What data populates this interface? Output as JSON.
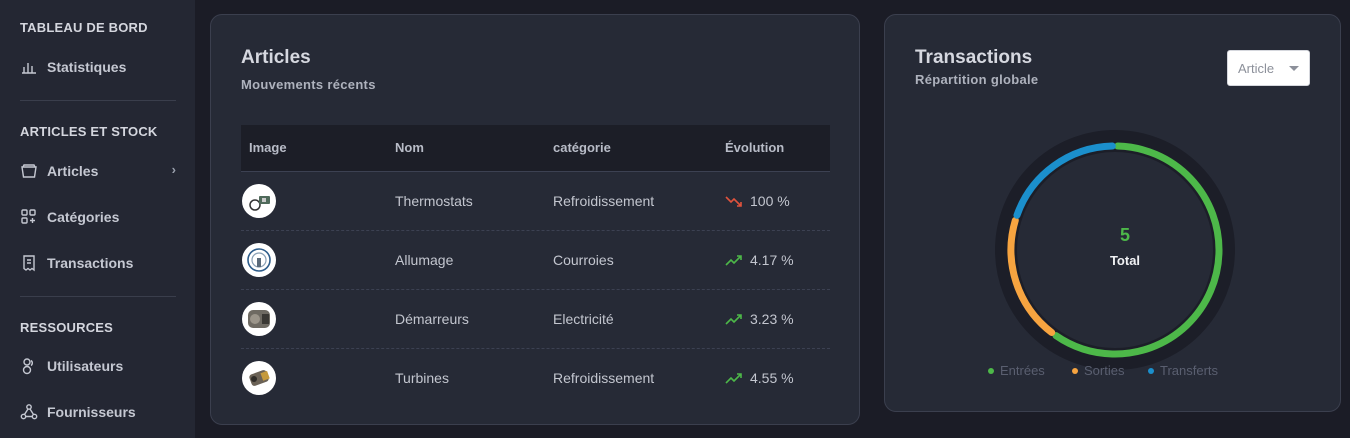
{
  "sidebar": {
    "sections": [
      {
        "title": "TABLEAU DE BORD",
        "items": [
          {
            "label": "Statistiques",
            "icon": "bar-chart-icon"
          }
        ]
      },
      {
        "title": "ARTICLES ET STOCK",
        "items": [
          {
            "label": "Articles",
            "icon": "basket-icon",
            "chevron": "›"
          },
          {
            "label": "Catégories",
            "icon": "category-icon"
          },
          {
            "label": "Transactions",
            "icon": "receipt-icon"
          }
        ]
      },
      {
        "title": "RESSOURCES",
        "items": [
          {
            "label": "Utilisateurs",
            "icon": "users-icon"
          },
          {
            "label": "Fournisseurs",
            "icon": "supplier-network-icon"
          }
        ]
      }
    ]
  },
  "articles_card": {
    "title": "Articles",
    "subtitle": "Mouvements récents",
    "columns": [
      "Image",
      "Nom",
      "catégorie",
      "Évolution"
    ],
    "rows": [
      {
        "thumb": "thermostat-thumbnail",
        "name": "Thermostats",
        "category": "Refroidissement",
        "trend": "down",
        "evolution": "100 %"
      },
      {
        "thumb": "ignition-thumbnail",
        "name": "Allumage",
        "category": "Courroies",
        "trend": "up",
        "evolution": "4.17 %"
      },
      {
        "thumb": "starter-thumbnail",
        "name": "Démarreurs",
        "category": "Electricité",
        "trend": "up",
        "evolution": "3.23 %"
      },
      {
        "thumb": "turbine-thumbnail",
        "name": "Turbines",
        "category": "Refroidissement",
        "trend": "up",
        "evolution": "4.55 %"
      }
    ],
    "colors": {
      "up": "#4db849",
      "down": "#e0533d"
    }
  },
  "transactions_card": {
    "title": "Transactions",
    "subtitle": "Répartition globale",
    "dropdown_value": "Article",
    "center_value": "5",
    "center_label": "Total",
    "legend": [
      {
        "label": "Entrées",
        "color": "#4db849"
      },
      {
        "label": "Sorties",
        "color": "#f7a440"
      },
      {
        "label": "Transferts",
        "color": "#1b8fcc"
      }
    ],
    "chart_data": {
      "type": "pie",
      "categories": [
        "Entrées",
        "Sorties",
        "Transferts"
      ],
      "values": [
        3,
        1,
        1
      ],
      "colors": [
        "#4db849",
        "#f7a440",
        "#1b8fcc"
      ],
      "title": "",
      "legend_position": "bottom"
    }
  }
}
